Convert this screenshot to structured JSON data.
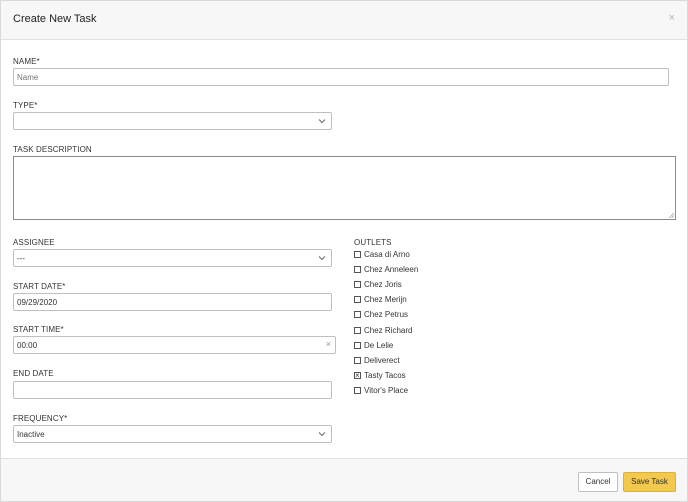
{
  "modal": {
    "title": "Create New Task",
    "close_icon": "close-icon"
  },
  "form": {
    "name": {
      "label": "NAME*",
      "placeholder": "Name",
      "value": ""
    },
    "type": {
      "label": "TYPE*",
      "value": ""
    },
    "description": {
      "label": "TASK DESCRIPTION",
      "value": ""
    },
    "assignee": {
      "label": "ASSIGNEE",
      "value": "---"
    },
    "start_date": {
      "label": "START DATE*",
      "value": "09/29/2020"
    },
    "start_time": {
      "label": "START TIME*",
      "value": "00:00",
      "clear_glyph": "×"
    },
    "end_date": {
      "label": "END DATE",
      "value": ""
    },
    "frequency": {
      "label": "FREQUENCY*",
      "value": "Inactive"
    }
  },
  "outlets": {
    "label": "OUTLETS",
    "items": [
      {
        "name": "Casa di Arno",
        "checked": false
      },
      {
        "name": "Chez Anneleen",
        "checked": false
      },
      {
        "name": "Chez Joris",
        "checked": false
      },
      {
        "name": "Chez Merijn",
        "checked": false
      },
      {
        "name": "Chez Petrus",
        "checked": false
      },
      {
        "name": "Chez Richard",
        "checked": false
      },
      {
        "name": "De Lelie",
        "checked": false
      },
      {
        "name": "Deliverect",
        "checked": false
      },
      {
        "name": "Tasty Tacos",
        "checked": true
      },
      {
        "name": "Vitor's Place",
        "checked": false
      }
    ]
  },
  "footer": {
    "cancel_label": "Cancel",
    "save_label": "Save Task"
  },
  "colors": {
    "accent": "#f2c94c",
    "header_bg": "#f7f7f7",
    "border": "#bfbfbf"
  }
}
